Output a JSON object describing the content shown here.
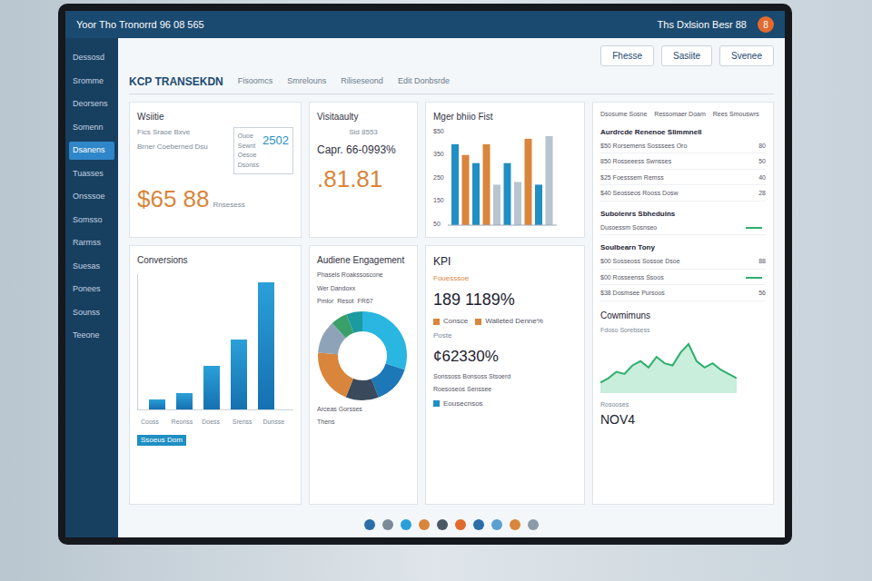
{
  "header": {
    "title": "Yoor Tho Tronorrd 96 08 565",
    "right": "Ths Dxlsion Besr 88",
    "avatar": "8"
  },
  "toolbar": {
    "buttons": [
      "Fhesse",
      "Sasiite",
      "Svenee"
    ]
  },
  "sidebar": {
    "items": [
      {
        "label": "Dessosd",
        "selected": false
      },
      {
        "label": "Sromme",
        "selected": false
      },
      {
        "label": "Deorsens",
        "selected": false
      },
      {
        "label": "Somenn",
        "selected": false
      },
      {
        "label": "Dsanens",
        "selected": true
      },
      {
        "label": "Tuasses",
        "selected": false
      },
      {
        "label": "Onsssoe",
        "selected": false
      },
      {
        "label": "Somsso",
        "selected": false
      },
      {
        "label": "Rarmss",
        "selected": false
      },
      {
        "label": "Suesas",
        "selected": false
      },
      {
        "label": "Ponees",
        "selected": false
      },
      {
        "label": "Sounss",
        "selected": false
      },
      {
        "label": "Teeone",
        "selected": false
      }
    ]
  },
  "tabs": [
    {
      "label": "Fisoomcs",
      "selected": false
    },
    {
      "label": "Smrelouns",
      "selected": false
    },
    {
      "label": "Riliseseond",
      "selected": false
    },
    {
      "label": "Edit Donbsrde",
      "selected": false
    }
  ],
  "page_title": "KCP TRANSEKDN",
  "summary_card": {
    "title": "Wsiitie",
    "lines": [
      "Fics Sraoe Bxve",
      "Brner Coeberned Dsu"
    ],
    "value": "$65 88",
    "unit": "Rnsesess",
    "mini": {
      "items": [
        "Ouoe",
        "Sewnt",
        "Oesoe",
        "Dsonss"
      ],
      "value": "2502"
    }
  },
  "visibility_card": {
    "title": "Visitaaulty",
    "note": "Sid 8553",
    "subtitle": "Capr. 66-0993%",
    "value": ".81.81"
  },
  "bar_card": {
    "title": "Mger bhiio Fist",
    "ticks": [
      "$50",
      "350",
      "250",
      "150",
      "50"
    ],
    "bars": [
      {
        "value": 300,
        "color": "#1f8fc4"
      },
      {
        "value": 260,
        "color": "#d9853b"
      },
      {
        "value": 230,
        "color": "#1f8fc4"
      },
      {
        "value": 300,
        "color": "#d9853b"
      },
      {
        "value": 150,
        "color": "#b8c4cf"
      },
      {
        "value": 230,
        "color": "#1f8fc4"
      },
      {
        "value": 160,
        "color": "#b8c4cf"
      },
      {
        "value": 320,
        "color": "#d9853b"
      },
      {
        "value": 150,
        "color": "#1f8fc4"
      },
      {
        "value": 330,
        "color": "#b8c4cf"
      }
    ]
  },
  "conversions": {
    "title": "Conversions",
    "values": [
      18,
      30,
      80,
      128,
      232
    ],
    "labels": [
      "Cooss",
      "Reonss",
      "Doess",
      "Srenss",
      "Dunsse"
    ],
    "footer": "Ssoeus Dom"
  },
  "engagement": {
    "title": "Audiene Engagement",
    "legend": [
      "Phasels Roakssoscone",
      "Wer Dandoxx"
    ],
    "labels": [
      "Pmlor",
      "Resot",
      "FR67"
    ],
    "segments": [
      {
        "value": 30,
        "color": "#29b6e0"
      },
      {
        "value": 14,
        "color": "#1d78b8"
      },
      {
        "value": 12,
        "color": "#3a4a5c"
      },
      {
        "value": 20,
        "color": "#d9853b"
      },
      {
        "value": 12,
        "color": "#8fa3b8"
      },
      {
        "value": 6,
        "color": "#3aa06a"
      },
      {
        "value": 6,
        "color": "#1b9aa0"
      }
    ],
    "notes": [
      "Arceas Gorsses",
      "Thens"
    ]
  },
  "kpi": {
    "title": "KPI",
    "subtitle": "Fouesssoe",
    "value": "189 1189%",
    "legend": [
      {
        "label": "Consce",
        "color": "#d9853b"
      },
      {
        "label": "Walleted Denne%",
        "color": "#d9853b"
      }
    ],
    "second_label": "Poste",
    "second_value": "¢62330%",
    "notes": [
      "Sonssoss Bonsoss Stsoerd",
      "Roesoseos Senssee"
    ],
    "footer": "Eousecnsos",
    "footer_color": "#1f8fc4"
  },
  "right": {
    "tabs": [
      "Dsosume Sosne",
      "Ressomaer Doam",
      "Rees Smouswrs"
    ],
    "sections": [
      {
        "title": "Aurdrcde Renenoe Slimmnell",
        "rows": [
          {
            "label": "$50 Rorsemens Sosssees Oro",
            "value": "80",
            "trend": false
          },
          {
            "label": "850 Rosseeess Swnsses",
            "value": "50",
            "trend": false
          },
          {
            "label": "$25 Foesssem Remss",
            "value": "40",
            "trend": false
          },
          {
            "label": "$40 Seosseos Rooss Dosw",
            "value": "28",
            "trend": false
          }
        ]
      },
      {
        "title": "Subolenrs Sbheduins",
        "rows": [
          {
            "label": "Dusoessm Sosnseo",
            "value": "",
            "trend": true
          }
        ]
      },
      {
        "title": "Soulbearn Tony",
        "rows": [
          {
            "label": "$00 Sosseoss Sossoe Dsoe",
            "value": "88",
            "trend": false
          },
          {
            "label": "$00 Rosseenss Ssoos",
            "value": "",
            "trend": true
          },
          {
            "label": "$38 Dosmsee Pursoos",
            "value": "56",
            "trend": false
          }
        ]
      }
    ]
  },
  "line_card": {
    "title": "Cowmimuns",
    "subtitle": "Fdoso Sorebsess",
    "values": [
      10,
      14,
      20,
      18,
      26,
      30,
      24,
      34,
      28,
      26,
      38,
      46,
      30,
      24,
      28,
      22,
      18,
      14
    ]
  },
  "footer_stat": {
    "label": "Rosooses",
    "value": "NOV4"
  },
  "dock": [
    {
      "color": "#2b6fa8"
    },
    {
      "color": "#7a8a99"
    },
    {
      "color": "#2ba0d8"
    },
    {
      "color": "#d9853b"
    },
    {
      "color": "#4a5866"
    },
    {
      "color": "#e36a2e"
    },
    {
      "color": "#2b6fa8"
    },
    {
      "color": "#5aa0d0"
    },
    {
      "color": "#d9853b"
    },
    {
      "color": "#8a9aa8"
    }
  ]
}
